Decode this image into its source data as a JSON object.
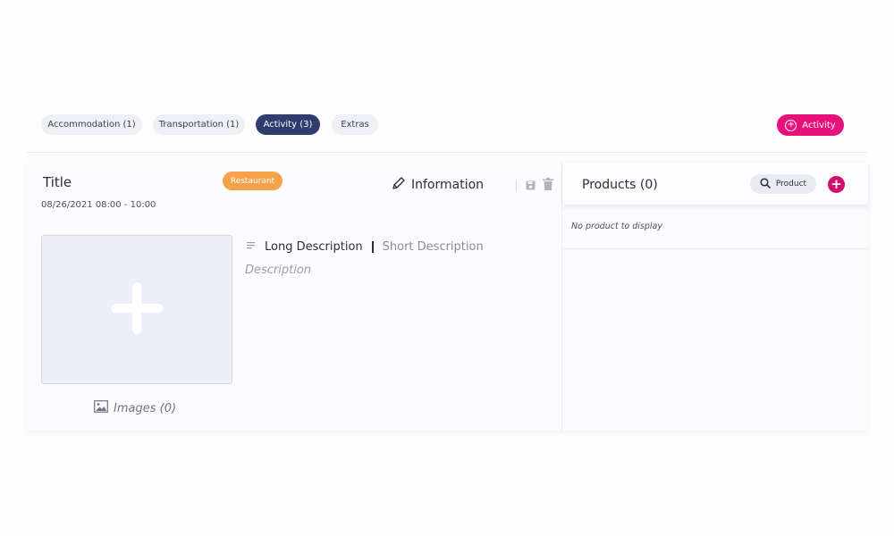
{
  "tabs": [
    {
      "label": "Accommodation (1)",
      "active": false
    },
    {
      "label": "Transportation (1)",
      "active": false
    },
    {
      "label": "Activity (3)",
      "active": true
    },
    {
      "label": "Extras",
      "active": false
    }
  ],
  "add_activity_label": "Activity",
  "activity": {
    "title": "Title",
    "datetime": "08/26/2021 08:00 - 10:00",
    "tag": "Restaurant",
    "info_label": "Information",
    "images_label": "Images (0)",
    "description_tabs": {
      "long": "Long Description",
      "short": "Short Description",
      "active": "long"
    },
    "description_placeholder": "Description"
  },
  "products": {
    "title": "Products (0)",
    "search_label": "Product",
    "empty_message": "No product to display"
  },
  "colors": {
    "accent": "#e6117a",
    "active_tab": "#2f3d6e",
    "tag": "#f6a24a"
  },
  "icons": [
    "plus-circle-icon",
    "pencil-icon",
    "save-icon",
    "trash-icon",
    "plus-icon",
    "image-icon",
    "text-lines-icon",
    "search-icon",
    "plus-icon"
  ]
}
